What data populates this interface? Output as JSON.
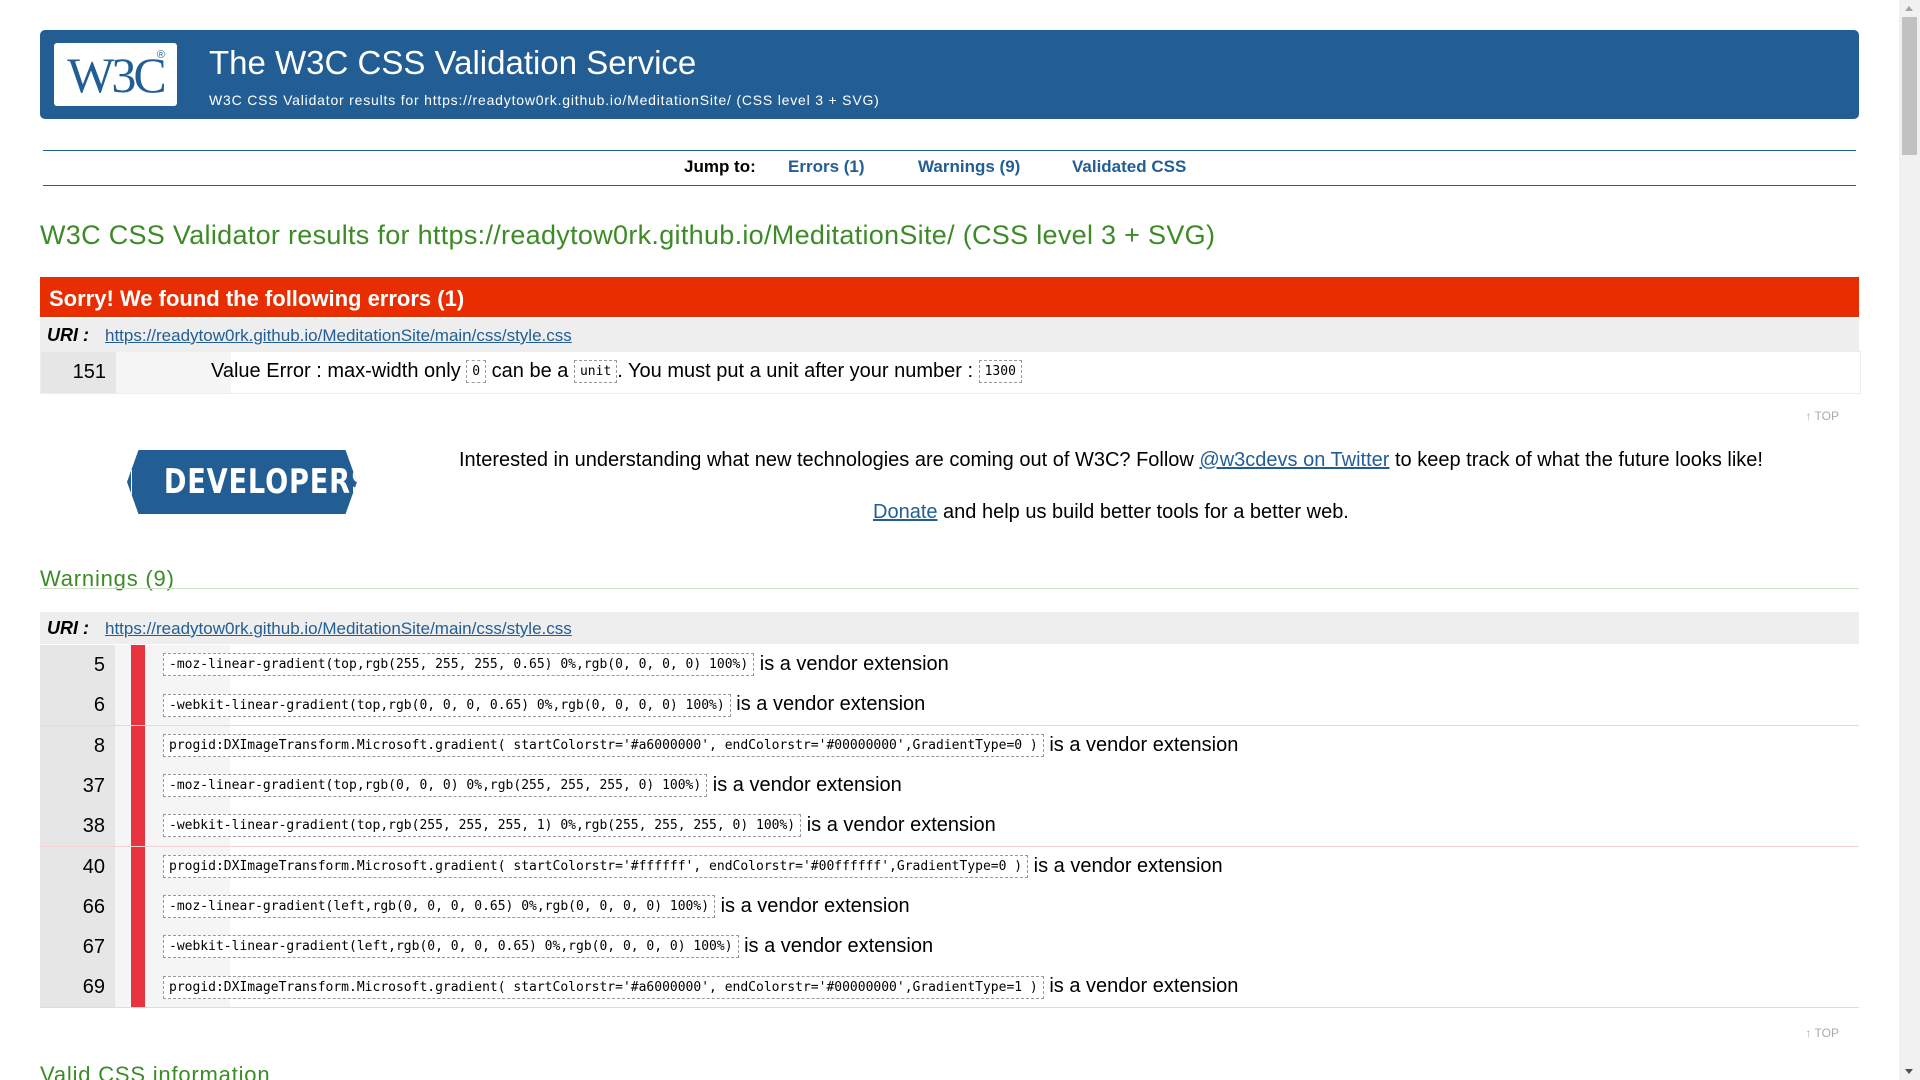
{
  "header": {
    "logo_text": "W3C",
    "title": "The W3C CSS Validation Service",
    "subtitle": "W3C CSS Validator results for https://readytow0rk.github.io/MeditationSite/ (CSS level 3 + SVG)"
  },
  "jump_nav": {
    "label": "Jump to:",
    "links": [
      "Errors (1)",
      "Warnings (9)",
      "Validated CSS"
    ]
  },
  "results_heading": "W3C CSS Validator results for https://readytow0rk.github.io/MeditationSite/ (CSS level 3 + SVG)",
  "errors": {
    "banner": "Sorry! We found the following errors (1)",
    "uri_label": "URI :",
    "uri": "https://readytow0rk.github.io/MeditationSite/main/css/style.css",
    "rows": [
      {
        "line": "151",
        "msg_1": "Value Error : max-width only",
        "code_1": "0",
        "msg_2": "can be a",
        "code_2": "unit",
        "msg_3": ". You must put a unit after your number :",
        "code_3": "1300"
      }
    ]
  },
  "top_link": "↑ TOP",
  "promo": {
    "logo_small": "W3C",
    "logo_big": "DEVELOPERS",
    "line1_before": "Interested in understanding what new technologies are coming out of W3C? Follow ",
    "line1_link": "@w3cdevs on Twitter",
    "line1_after": " to keep track of what the future looks like!",
    "donate_link": "Donate",
    "donate_after": " and help us build better tools for a better web."
  },
  "warnings": {
    "heading": "Warnings (9)",
    "uri_label": "URI :",
    "uri": "https://readytow0rk.github.io/MeditationSite/main/css/style.css",
    "suffix": "is a vendor extension",
    "rows": [
      {
        "line": "5",
        "code": "-moz-linear-gradient(top,rgb(255, 255, 255, 0.65) 0%,rgb(0, 0, 0, 0) 100%)"
      },
      {
        "line": "6",
        "code": "-webkit-linear-gradient(top,rgb(0, 0, 0, 0.65) 0%,rgb(0, 0, 0, 0) 100%)"
      },
      {
        "line": "8",
        "code": "progid:DXImageTransform.Microsoft.gradient( startColorstr='#a6000000', endColorstr='#00000000',GradientType=0 )"
      },
      {
        "line": "37",
        "code": "-moz-linear-gradient(top,rgb(0, 0, 0) 0%,rgb(255, 255, 255, 0) 100%)"
      },
      {
        "line": "38",
        "code": "-webkit-linear-gradient(top,rgb(255, 255, 255, 1) 0%,rgb(255, 255, 255, 0) 100%)"
      },
      {
        "line": "40",
        "code": "progid:DXImageTransform.Microsoft.gradient( startColorstr='#ffffff', endColorstr='#00ffffff',GradientType=0 )"
      },
      {
        "line": "66",
        "code": "-moz-linear-gradient(left,rgb(0, 0, 0, 0.65) 0%,rgb(0, 0, 0, 0) 100%)"
      },
      {
        "line": "67",
        "code": "-webkit-linear-gradient(left,rgb(0, 0, 0, 0.65) 0%,rgb(0, 0, 0, 0) 100%)"
      },
      {
        "line": "69",
        "code": "progid:DXImageTransform.Microsoft.gradient( startColorstr='#a6000000', endColorstr='#00000000',GradientType=1 )"
      }
    ]
  },
  "valid_heading": "Valid CSS information",
  "colors": {
    "brand_blue": "#225e94",
    "heading_green": "#3d8b27",
    "error_red": "#e82e00",
    "warning_marker": "#e8343f"
  }
}
